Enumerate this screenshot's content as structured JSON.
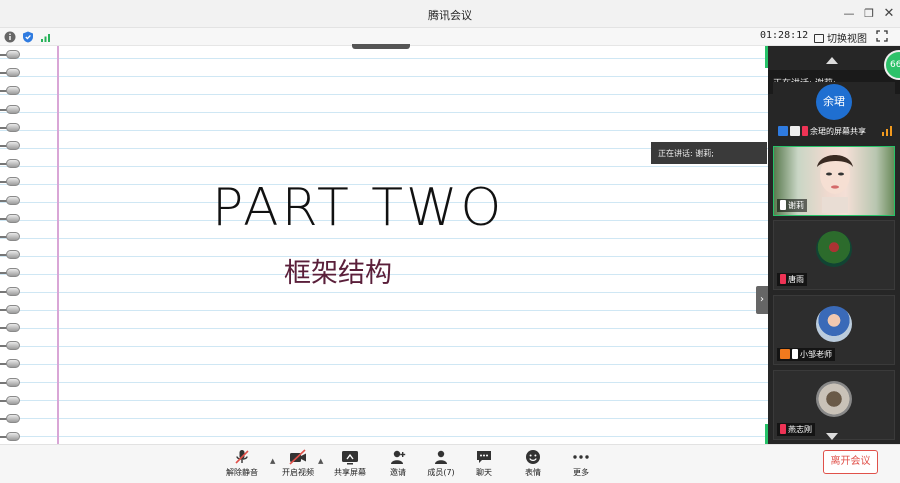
{
  "window": {
    "title": "腾讯会议"
  },
  "statusbar": {
    "timer": "01:28:12",
    "switch_view_label": "切换视图"
  },
  "slide": {
    "title": "PART TWO",
    "subtitle": "框架结构",
    "speaking_label": "正在讲话: 谢莉;"
  },
  "panel": {
    "speaking_label": "正在讲话: 谢莉;",
    "participant_count_badge": "66",
    "tiles": [
      {
        "name": "余珺的屏幕共享",
        "avatar_text": "余珺"
      },
      {
        "name": "谢莉"
      },
      {
        "name": "唐雨"
      },
      {
        "name": "小邹老师"
      },
      {
        "name": "燕志刚"
      }
    ]
  },
  "toolbar": {
    "unmute": "解除静音",
    "start_video": "开启视频",
    "share_screen": "共享屏幕",
    "invite": "邀请",
    "members": "成员(7)",
    "chat": "聊天",
    "reactions": "表情",
    "more": "更多",
    "leave": "离开会议"
  },
  "colors": {
    "accent_green": "#26c268",
    "leave_red": "#e0514a",
    "avatar_blue": "#1f6fd1"
  }
}
